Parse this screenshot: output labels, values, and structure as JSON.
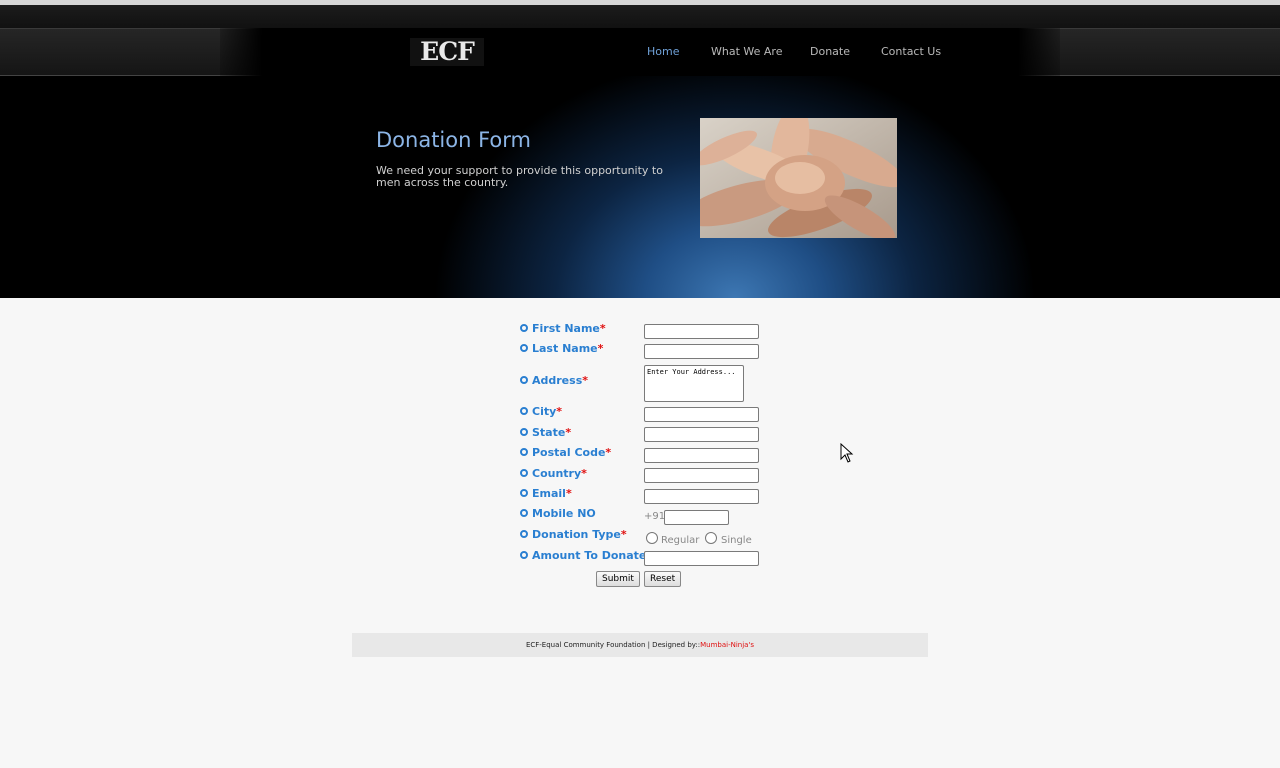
{
  "header": {
    "logo_text": "ECF",
    "nav": [
      {
        "label": "Home",
        "active": true
      },
      {
        "label": "What We Are"
      },
      {
        "label": "Donate"
      },
      {
        "label": "Contact Us"
      }
    ]
  },
  "hero": {
    "title": "Donation Form",
    "subtitle": "We need your support to provide this opportunity to men across the country."
  },
  "form": {
    "fields": [
      {
        "label": "First Name",
        "required": "*"
      },
      {
        "label": "Last Name",
        "required": "*"
      },
      {
        "label": "Address",
        "required": "*",
        "placeholder": "Enter Your Address..."
      },
      {
        "label": "City",
        "required": "*"
      },
      {
        "label": "State",
        "required": "*"
      },
      {
        "label": "Postal Code",
        "required": "*"
      },
      {
        "label": "Country",
        "required": "*"
      },
      {
        "label": "Email",
        "required": "*"
      },
      {
        "label": "Mobile NO",
        "prefix": "+91"
      },
      {
        "label": "Donation Type",
        "required": "*",
        "options": [
          "Regular",
          "Single"
        ]
      },
      {
        "label": "Amount To Donate",
        "required": "*"
      }
    ],
    "submit_label": "Submit",
    "reset_label": "Reset"
  },
  "footer": {
    "text": "ECF-Equal Community Foundation | Designed by::",
    "credit": "Mumbai-Ninja's"
  },
  "colors": {
    "accent": "#2a7fd1",
    "required": "#e01010",
    "nav_active": "#6fa1d8"
  }
}
